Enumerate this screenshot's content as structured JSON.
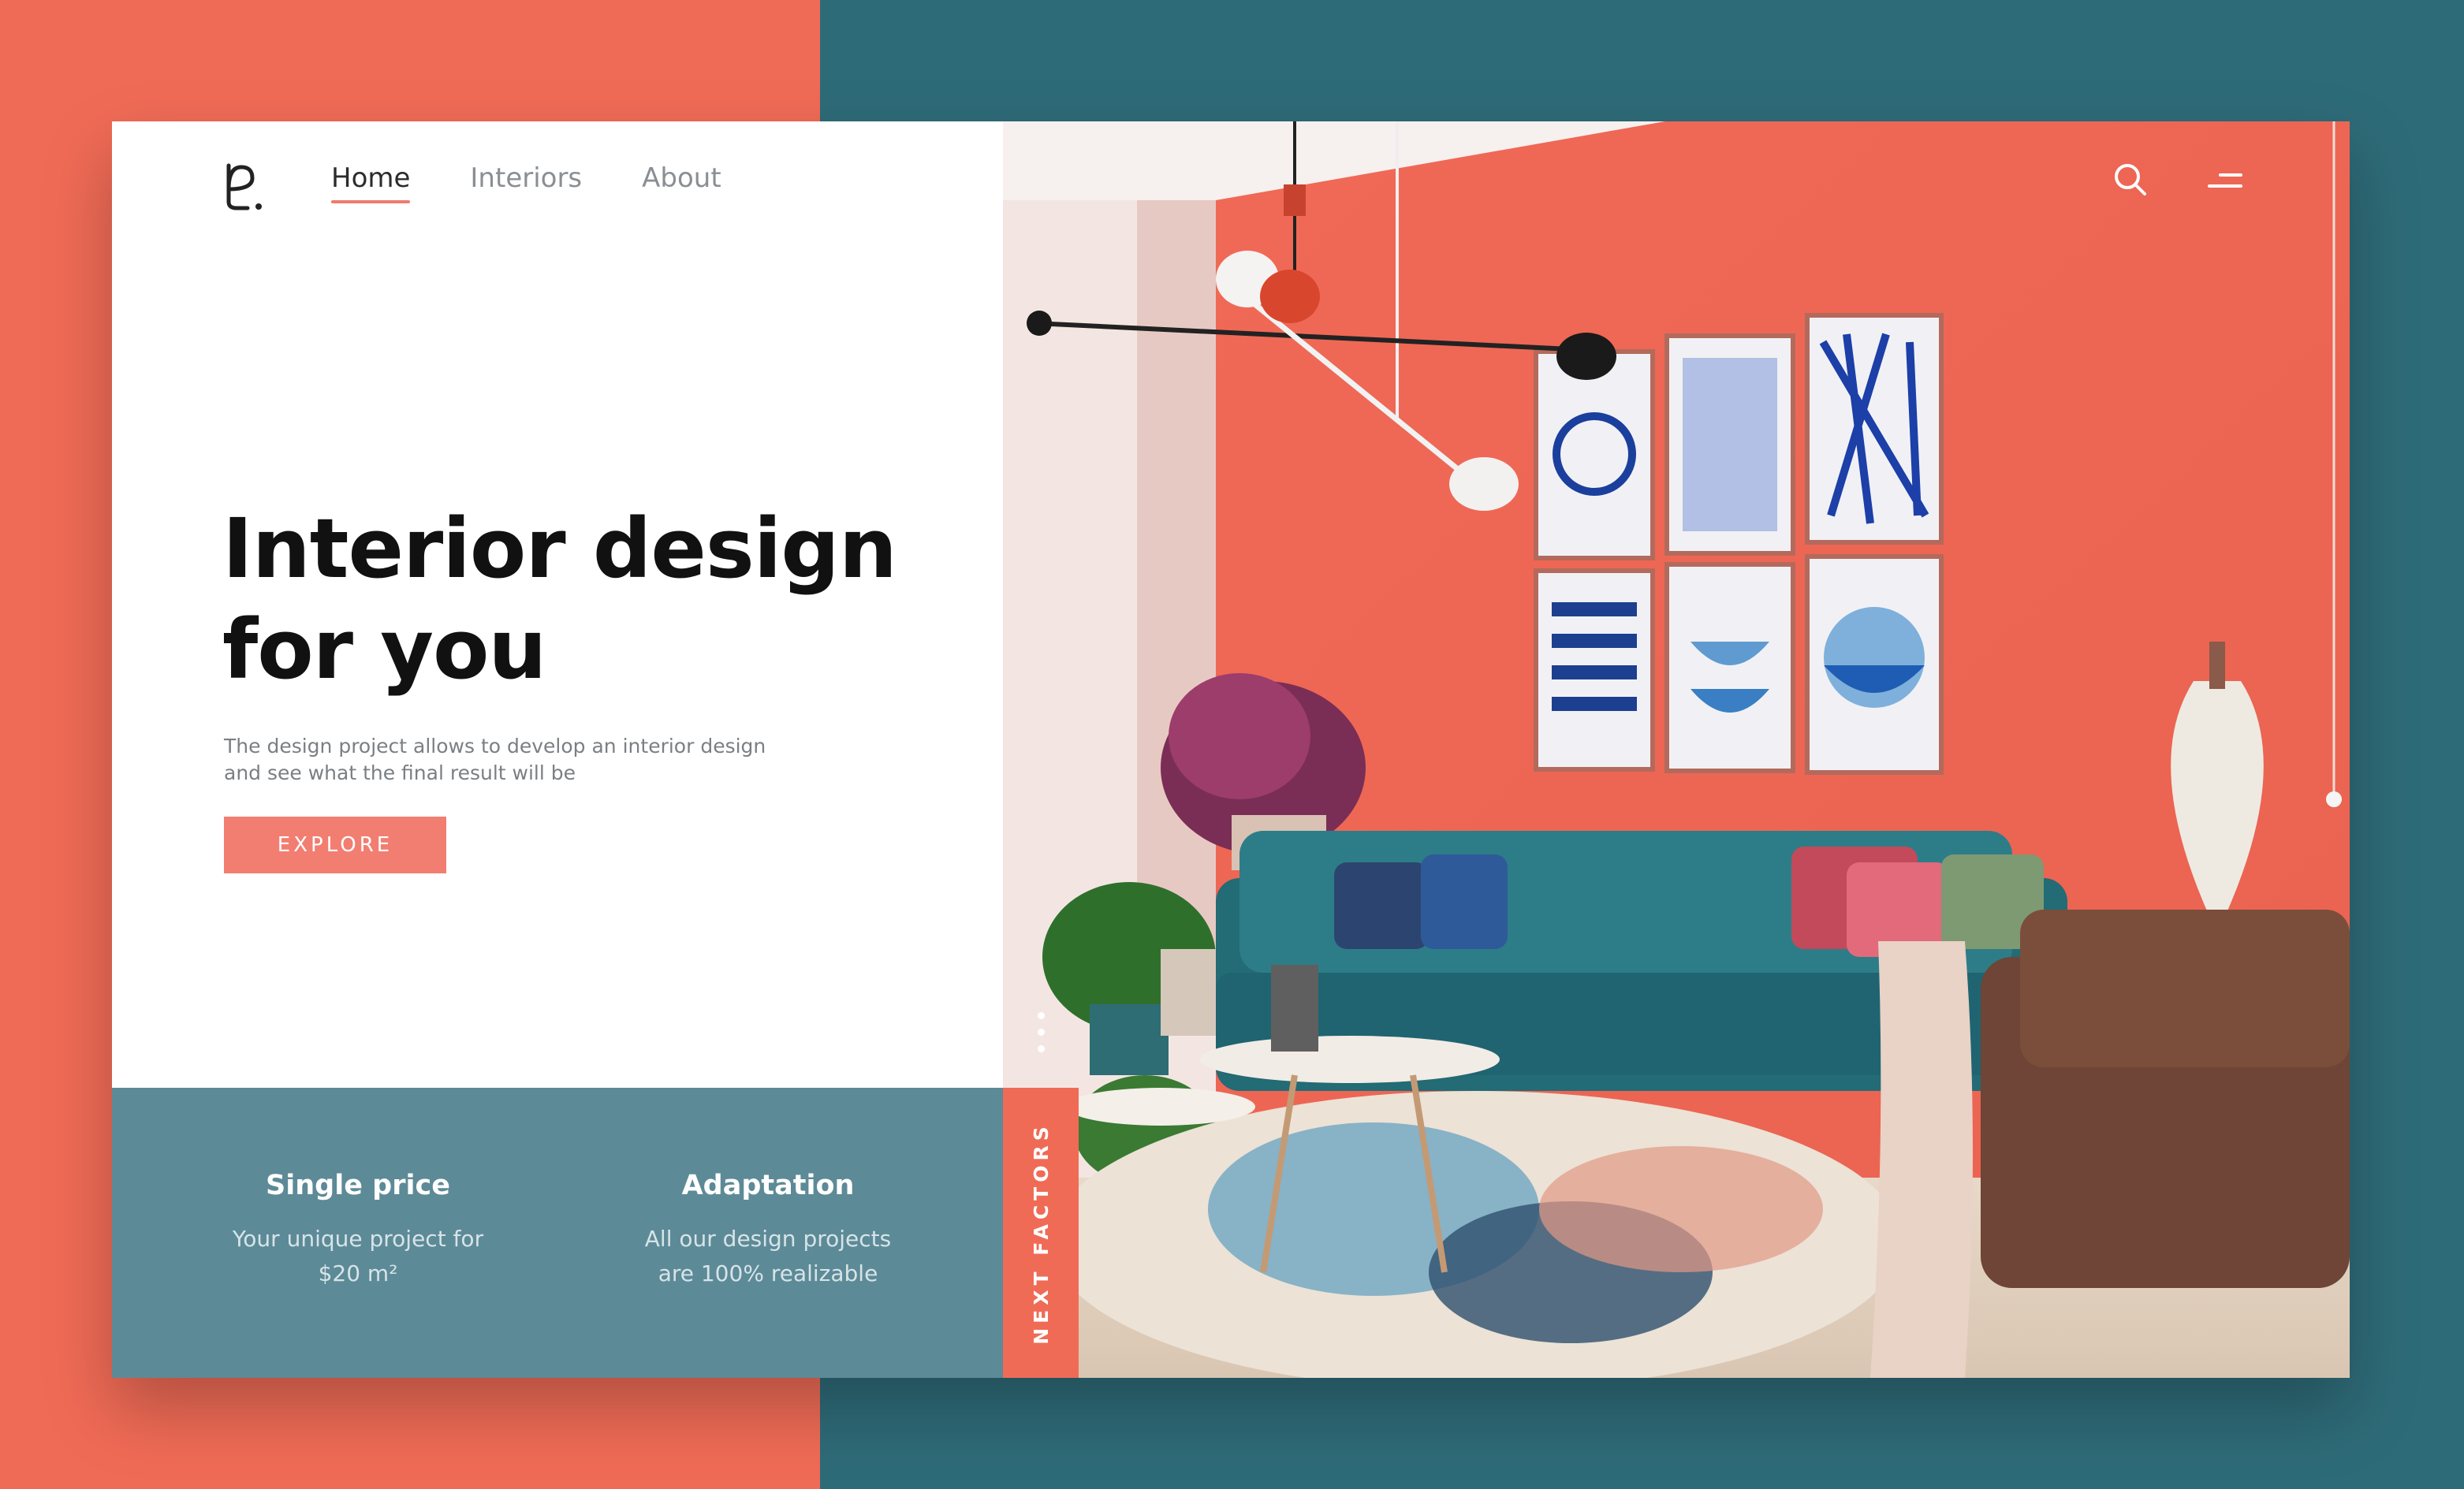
{
  "colors": {
    "coral": "#f06b56",
    "teal": "#2e6b78",
    "feature_teal": "#5d8a97",
    "button_coral": "#f17e71",
    "accent_underline": "#f07a6c"
  },
  "nav": {
    "logo_icon": "logo-icon",
    "items": [
      {
        "label": "Home",
        "active": true
      },
      {
        "label": "Interiors",
        "active": false
      },
      {
        "label": "About",
        "active": false
      }
    ],
    "search_icon": "search-icon",
    "menu_icon": "menu-icon"
  },
  "hero": {
    "title_line1": "Interior design",
    "title_line2": "for you",
    "description_line1": "The design project allows to develop an interior design",
    "description_line2": "and see what the final result will be",
    "cta_label": "EXPLORE"
  },
  "features": [
    {
      "title": "Single price",
      "text_line1": "Your unique project for",
      "text_line2": "$20 m²"
    },
    {
      "title": "Adaptation",
      "text_line1": "All our design projects",
      "text_line2": "are 100% realizable"
    }
  ],
  "side_tab": {
    "label": "NEXT FACTORS"
  }
}
